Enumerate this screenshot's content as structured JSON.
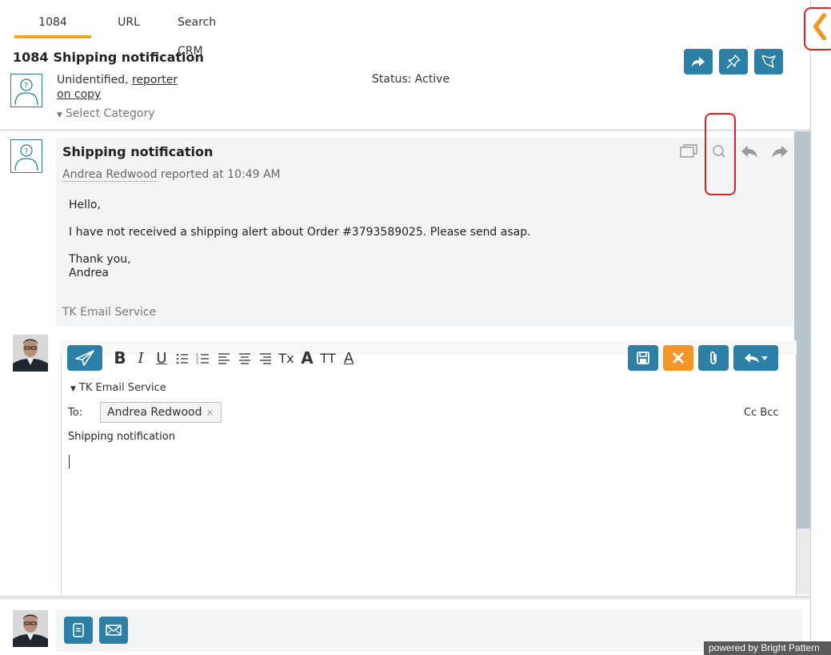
{
  "tabs": [
    {
      "label": "1084"
    },
    {
      "label": "URL"
    },
    {
      "label": "Search CRM"
    }
  ],
  "case": {
    "id": "1084",
    "title": "Shipping notification",
    "customer": "Unidentified,",
    "reporter_link": "reporter",
    "on_copy_link": "on copy",
    "status": "Status: Active",
    "category_placeholder": "Select Category"
  },
  "message": {
    "title": "Shipping notification",
    "author": "Andrea Redwood",
    "reported": "reported at 10:49 AM",
    "greeting": "Hello,",
    "body": "I have not received a shipping alert about Order #3793589025. Please send asap.",
    "closing": "Thank you,",
    "name": "Andrea",
    "signature": "TK Email Service"
  },
  "editor": {
    "from": "TK Email Service",
    "to_label": "To:",
    "to_recipient": "Andrea Redwood",
    "chip_remove": "×",
    "cc_bcc": "Cc Bcc",
    "subject": "Shipping notification",
    "format_buttons": {
      "bold": "B",
      "italic": "I",
      "underline": "U",
      "clear": "Tx",
      "font": "A",
      "size": "TT",
      "color": "A"
    }
  },
  "footer": {
    "powered": "powered by Bright Pattern"
  },
  "colors": {
    "accent_teal": "#2c7fa5",
    "accent_orange": "#f39527",
    "highlight_red": "#e0211f",
    "tab_underline": "#f5a623"
  },
  "icons": [
    "forward-icon",
    "pin-icon",
    "flag-icon",
    "screens-icon",
    "search-icon",
    "reply-icon",
    "send-icon",
    "save-icon",
    "close-icon",
    "attachment-icon",
    "note-icon",
    "mail-icon",
    "chevron-left-icon"
  ]
}
